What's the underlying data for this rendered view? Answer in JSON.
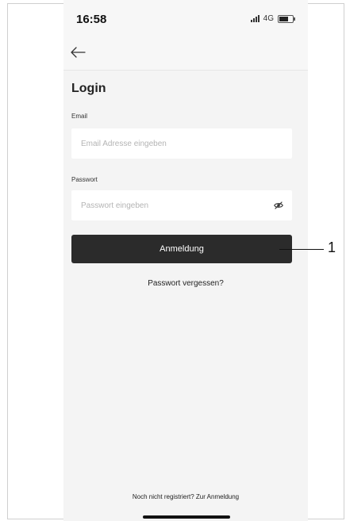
{
  "status_bar": {
    "time": "16:58",
    "network": "4G"
  },
  "nav": {
    "back_icon": "arrow-left-icon"
  },
  "login": {
    "title": "Login",
    "email_label": "Email",
    "email_placeholder": "Email Adresse eingeben",
    "email_value": "",
    "password_label": "Passwort",
    "password_placeholder": "Passwort eingeben",
    "password_value": "",
    "visibility_icon": "eye-hidden-icon",
    "submit_label": "Anmeldung",
    "forgot_label": "Passwort vergessen?"
  },
  "footer": {
    "register_text": "Noch nicht registriert? Zur Anmeldung"
  },
  "annotation": {
    "callout_number": "1"
  },
  "colors": {
    "button_bg": "#2b2b2b",
    "screen_bg": "#f4f4f4",
    "field_bg": "#ffffff"
  }
}
